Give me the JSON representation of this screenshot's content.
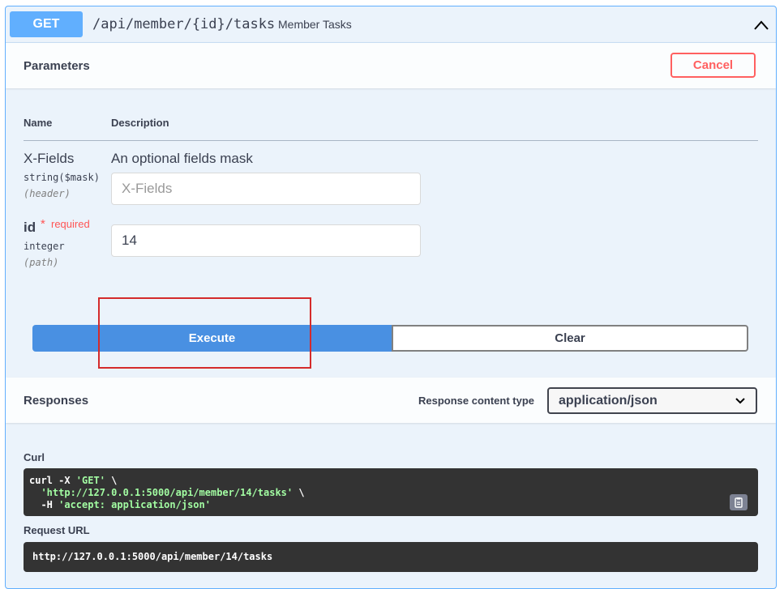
{
  "operation": {
    "method": "GET",
    "path": "/api/member/{id}/tasks",
    "summary": "Member Tasks"
  },
  "parameters": {
    "title": "Parameters",
    "cancel_label": "Cancel",
    "col_name": "Name",
    "col_description": "Description",
    "items": [
      {
        "name": "X-Fields",
        "type": "string($mask)",
        "in": "(header)",
        "description": "An optional fields mask",
        "value": "",
        "placeholder": "X-Fields"
      },
      {
        "name": "id",
        "required_star": "*",
        "required_label": "required",
        "type": "integer",
        "in": "(path)",
        "value": "14"
      }
    ]
  },
  "actions": {
    "execute_label": "Execute",
    "clear_label": "Clear"
  },
  "responses": {
    "title": "Responses",
    "content_type_label": "Response content type",
    "content_type_value": "application/json"
  },
  "curl": {
    "label": "Curl",
    "line1_cmd": "curl -X ",
    "line1_str": "'GET'",
    "line1_end": " \\",
    "line2_pre": "  ",
    "line2_str": "'http://127.0.0.1:5000/api/member/14/tasks'",
    "line2_end": " \\",
    "line3_pre": "  -H ",
    "line3_str": "'accept: application/json'"
  },
  "request_url": {
    "label": "Request URL",
    "value": "http://127.0.0.1:5000/api/member/14/tasks"
  },
  "colors": {
    "get_blue": "#61affe",
    "execute_blue": "#4990e2",
    "cancel_red": "#ff6060",
    "highlight_red": "#d42b2b"
  }
}
